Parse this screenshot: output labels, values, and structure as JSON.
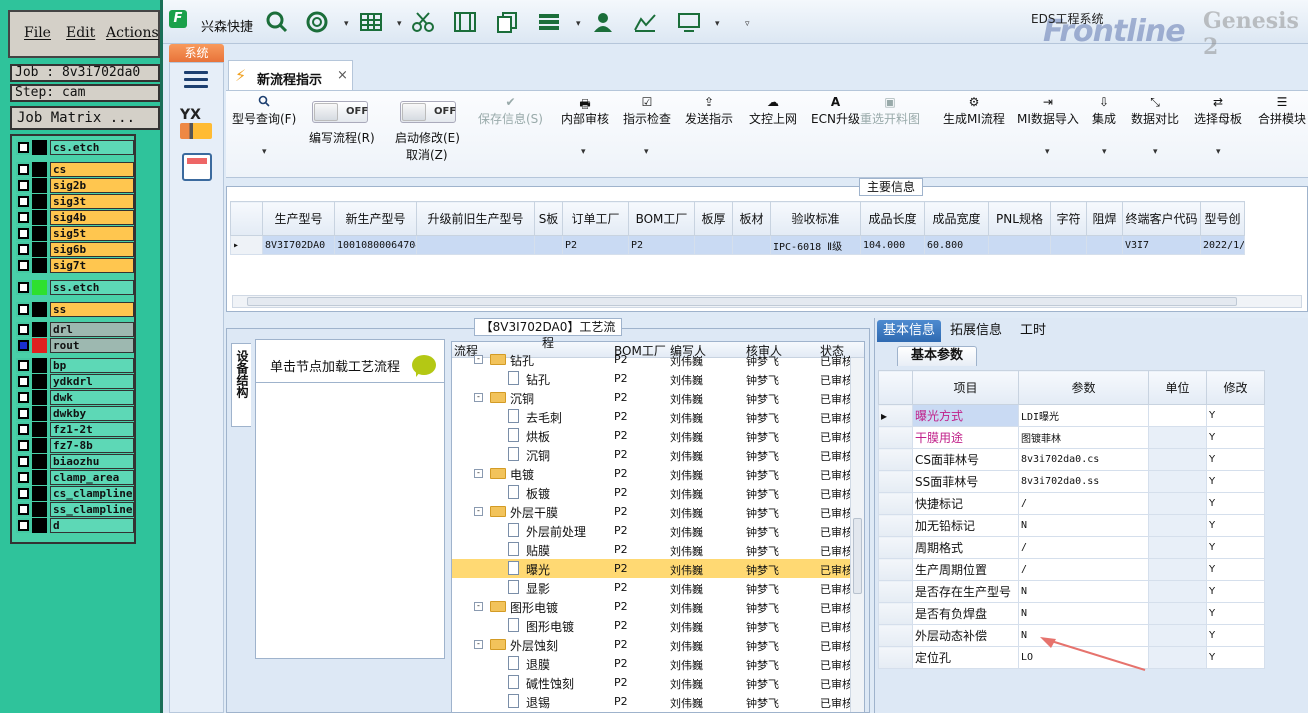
{
  "genesis": {
    "menu": [
      "File",
      "Edit",
      "Actions"
    ],
    "job": "Job : 8v3i702da0",
    "step": "Step: cam",
    "job_matrix": "Job Matrix ...",
    "layers": [
      {
        "name": "cs.etch",
        "bg": "#5dd8b6",
        "swatch": "#000"
      },
      {
        "name": "cs",
        "bg": "#ffc64f",
        "swatch": "#000"
      },
      {
        "name": "sig2b",
        "bg": "#ffc64f",
        "swatch": "#000"
      },
      {
        "name": "sig3t",
        "bg": "#ffc64f",
        "swatch": "#000"
      },
      {
        "name": "sig4b",
        "bg": "#ffc64f",
        "swatch": "#000"
      },
      {
        "name": "sig5t",
        "bg": "#ffc64f",
        "swatch": "#000"
      },
      {
        "name": "sig6b",
        "bg": "#ffc64f",
        "swatch": "#000"
      },
      {
        "name": "sig7t",
        "bg": "#ffc64f",
        "swatch": "#000"
      },
      {
        "name": "ss.etch",
        "bg": "#5dd8b6",
        "swatch": "#2ee02e"
      },
      {
        "name": "ss",
        "bg": "#ffc64f",
        "swatch": "#000"
      },
      {
        "name": "drl",
        "bg": "#9db8b0",
        "swatch": "#000"
      },
      {
        "name": "rout",
        "bg": "#9db8b0",
        "swatch": "#e02020"
      },
      {
        "name": "bp",
        "bg": "#5dd8b6",
        "swatch": "#000"
      },
      {
        "name": "ydkdrl",
        "bg": "#5dd8b6",
        "swatch": "#000"
      },
      {
        "name": "dwk",
        "bg": "#5dd8b6",
        "swatch": "#000"
      },
      {
        "name": "dwkby",
        "bg": "#5dd8b6",
        "swatch": "#000"
      },
      {
        "name": "fz1-2t",
        "bg": "#5dd8b6",
        "swatch": "#000"
      },
      {
        "name": "fz7-8b",
        "bg": "#5dd8b6",
        "swatch": "#000"
      },
      {
        "name": "biaozhu",
        "bg": "#5dd8b6",
        "swatch": "#000"
      },
      {
        "name": "clamp_area",
        "bg": "#5dd8b6",
        "swatch": "#000"
      },
      {
        "name": "cs_clampline",
        "bg": "#5dd8b6",
        "swatch": "#000"
      },
      {
        "name": "ss_clampline",
        "bg": "#5dd8b6",
        "swatch": "#000"
      },
      {
        "name": "d",
        "bg": "#5dd8b6",
        "swatch": "#000"
      }
    ]
  },
  "app": {
    "name": "兴森快捷",
    "window_title": "EDS工程系统",
    "brand": "Frontline",
    "brand2": "Genesis 2",
    "system_tab": "系统",
    "yx": "YX",
    "doc_tab": "新流程指示",
    "close": "×"
  },
  "ribbon": {
    "query": "型号查询(F)",
    "edit_flow": "编写流程(R)",
    "edit_flow_toggle": "OFF",
    "start_modify": "启动修改(E)",
    "start_modify_toggle": "OFF",
    "cancel": "取消(Z)",
    "buttons": [
      "保存信息(S)",
      "内部审核",
      "指示检查",
      "发送指示",
      "文控上网",
      "ECN升级",
      "重选开料图",
      "生成MI流程",
      "MI数据导入",
      "集成",
      "数据对比",
      "选择母板",
      "合拼模块"
    ]
  },
  "main_info": {
    "title": "主要信息",
    "headers": [
      "生产型号",
      "新生产型号",
      "升级前旧生产型号",
      "S板",
      "订单工厂",
      "BOM工厂",
      "板厚",
      "板材",
      "验收标准",
      "成品长度",
      "成品宽度",
      "PNL规格",
      "字符",
      "阻焊",
      "终端客户代码",
      "型号创"
    ],
    "row": [
      "8V3I702DA0",
      "10010800064704",
      "",
      "",
      "P2",
      "P2",
      "",
      "",
      "IPC-6018 Ⅱ级",
      "104.000",
      "60.800",
      "",
      "",
      "",
      "V3I7",
      "2022/1/"
    ]
  },
  "process": {
    "title": "【8V3I702DA0】工艺流程",
    "side_tab": "设备结构",
    "hint": "单击节点加载工艺流程",
    "headers": [
      "流程",
      "BOM工厂",
      "编写人",
      "核审人",
      "状态"
    ],
    "rows": [
      {
        "name": "钻孔",
        "level": 0,
        "folder": true,
        "bom": "P2",
        "writer": "刘伟巍",
        "reviewer": "钟梦飞",
        "status": "已审核"
      },
      {
        "name": "钻孔",
        "level": 1,
        "folder": false,
        "bom": "P2",
        "writer": "刘伟巍",
        "reviewer": "钟梦飞",
        "status": "已审核"
      },
      {
        "name": "沉铜",
        "level": 0,
        "folder": true,
        "bom": "P2",
        "writer": "刘伟巍",
        "reviewer": "钟梦飞",
        "status": "已审核"
      },
      {
        "name": "去毛刺",
        "level": 1,
        "folder": false,
        "bom": "P2",
        "writer": "刘伟巍",
        "reviewer": "钟梦飞",
        "status": "已审核"
      },
      {
        "name": "烘板",
        "level": 1,
        "folder": false,
        "bom": "P2",
        "writer": "刘伟巍",
        "reviewer": "钟梦飞",
        "status": "已审核"
      },
      {
        "name": "沉铜",
        "level": 1,
        "folder": false,
        "bom": "P2",
        "writer": "刘伟巍",
        "reviewer": "钟梦飞",
        "status": "已审核"
      },
      {
        "name": "电镀",
        "level": 0,
        "folder": true,
        "bom": "P2",
        "writer": "刘伟巍",
        "reviewer": "钟梦飞",
        "status": "已审核"
      },
      {
        "name": "板镀",
        "level": 1,
        "folder": false,
        "bom": "P2",
        "writer": "刘伟巍",
        "reviewer": "钟梦飞",
        "status": "已审核"
      },
      {
        "name": "外层干膜",
        "level": 0,
        "folder": true,
        "bom": "P2",
        "writer": "刘伟巍",
        "reviewer": "钟梦飞",
        "status": "已审核"
      },
      {
        "name": "外层前处理",
        "level": 1,
        "folder": false,
        "bom": "P2",
        "writer": "刘伟巍",
        "reviewer": "钟梦飞",
        "status": "已审核"
      },
      {
        "name": "贴膜",
        "level": 1,
        "folder": false,
        "bom": "P2",
        "writer": "刘伟巍",
        "reviewer": "钟梦飞",
        "status": "已审核"
      },
      {
        "name": "曝光",
        "level": 1,
        "folder": false,
        "bom": "P2",
        "writer": "刘伟巍",
        "reviewer": "钟梦飞",
        "status": "已审核",
        "selected": true
      },
      {
        "name": "显影",
        "level": 1,
        "folder": false,
        "bom": "P2",
        "writer": "刘伟巍",
        "reviewer": "钟梦飞",
        "status": "已审核"
      },
      {
        "name": "图形电镀",
        "level": 0,
        "folder": true,
        "bom": "P2",
        "writer": "刘伟巍",
        "reviewer": "钟梦飞",
        "status": "已审核"
      },
      {
        "name": "图形电镀",
        "level": 1,
        "folder": false,
        "bom": "P2",
        "writer": "刘伟巍",
        "reviewer": "钟梦飞",
        "status": "已审核"
      },
      {
        "name": "外层蚀刻",
        "level": 0,
        "folder": true,
        "bom": "P2",
        "writer": "刘伟巍",
        "reviewer": "钟梦飞",
        "status": "已审核"
      },
      {
        "name": "退膜",
        "level": 1,
        "folder": false,
        "bom": "P2",
        "writer": "刘伟巍",
        "reviewer": "钟梦飞",
        "status": "已审核"
      },
      {
        "name": "碱性蚀刻",
        "level": 1,
        "folder": false,
        "bom": "P2",
        "writer": "刘伟巍",
        "reviewer": "钟梦飞",
        "status": "已审核"
      },
      {
        "name": "退锡",
        "level": 1,
        "folder": false,
        "bom": "P2",
        "writer": "刘伟巍",
        "reviewer": "钟梦飞",
        "status": "已审核"
      }
    ]
  },
  "info": {
    "tabs": [
      "基本信息",
      "拓展信息",
      "工时"
    ],
    "subtab": "基本参数",
    "headers": [
      "项目",
      "参数",
      "单位",
      "修改"
    ],
    "rows": [
      {
        "item": "曝光方式",
        "value": "LDI曝光",
        "unit": "",
        "mod": "Y",
        "color": "#c0208a"
      },
      {
        "item": "干膜用途",
        "value": "图镀菲林",
        "unit": "",
        "mod": "Y",
        "color": "#c0208a"
      },
      {
        "item": "CS面菲林号",
        "value": "8v3i702da0.cs",
        "unit": "",
        "mod": "Y",
        "color": "#111"
      },
      {
        "item": "SS面菲林号",
        "value": "8v3i702da0.ss",
        "unit": "",
        "mod": "Y",
        "color": "#111"
      },
      {
        "item": "快捷标记",
        "value": "/",
        "unit": "",
        "mod": "Y",
        "color": "#111"
      },
      {
        "item": "加无铅标记",
        "value": "N",
        "unit": "",
        "mod": "Y",
        "color": "#111"
      },
      {
        "item": "周期格式",
        "value": "/",
        "unit": "",
        "mod": "Y",
        "color": "#111"
      },
      {
        "item": "生产周期位置",
        "value": "/",
        "unit": "",
        "mod": "Y",
        "color": "#111"
      },
      {
        "item": "是否存在生产型号",
        "value": "N",
        "unit": "",
        "mod": "Y",
        "color": "#111"
      },
      {
        "item": "是否有负焊盘",
        "value": "N",
        "unit": "",
        "mod": "Y",
        "color": "#111"
      },
      {
        "item": "外层动态补偿",
        "value": "N",
        "unit": "",
        "mod": "Y",
        "color": "#111"
      },
      {
        "item": "定位孔",
        "value": "LO",
        "unit": "",
        "mod": "Y",
        "color": "#111"
      }
    ]
  }
}
